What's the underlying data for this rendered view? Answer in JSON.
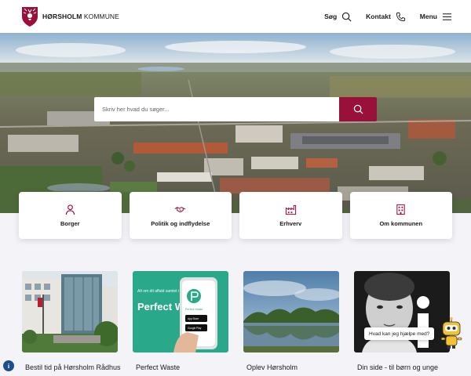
{
  "brand": {
    "name_bold": "HØRSHOLM",
    "name_rest": " KOMMUNE"
  },
  "nav": {
    "search_label": "Søg",
    "contact_label": "Kontakt",
    "menu_label": "Menu"
  },
  "search": {
    "placeholder": "Skriv her hvad du søger..."
  },
  "categories": [
    {
      "label": "Borger",
      "icon": "person-icon"
    },
    {
      "label": "Politik og indflydelse",
      "icon": "handshake-icon"
    },
    {
      "label": "Erhverv",
      "icon": "factory-icon"
    },
    {
      "label": "Om kommunen",
      "icon": "building-icon"
    }
  ],
  "news": [
    {
      "title": "Bestil tid på Hørsholm Rådhus"
    },
    {
      "title": "Perfect Waste",
      "promo_small": "Alt om dit affald samlet i vores app",
      "promo_big": "Perfect Waste",
      "phone_brand": "Perfect Waste",
      "app_store": "App Store",
      "google_play": "Google Play"
    },
    {
      "title": "Oplev Hørsholm"
    },
    {
      "title": "Din side - til børn og unge"
    }
  ],
  "chat": {
    "text": "Hvad kan jeg hjælpe med?"
  },
  "info": {
    "label": "i"
  },
  "colors": {
    "brand": "#99103a",
    "background": "#f4f3f8",
    "card": "#ffffff"
  }
}
